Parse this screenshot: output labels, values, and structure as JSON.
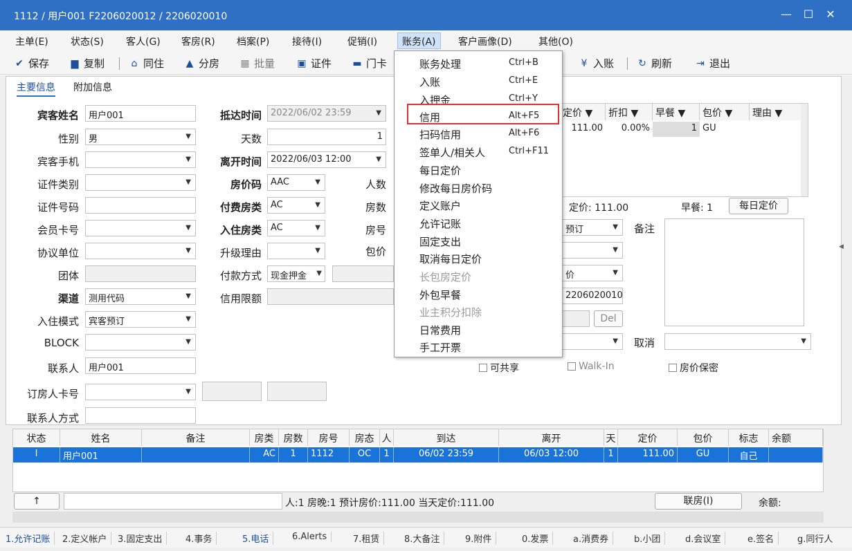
{
  "window": {
    "title": "1112 / 用户001 F2206020012 / 2206020010",
    "minimize": "—",
    "maximize": "☐",
    "close": "✕"
  },
  "menubar": [
    "主单(E)",
    "状态(S)",
    "客人(G)",
    "客房(R)",
    "档案(P)",
    "接待(I)",
    "促销(I)",
    "账务(A)",
    "客户画像(D)",
    "其他(O)"
  ],
  "toolbar": {
    "save": "保存",
    "copy": "复制",
    "cohabit": "同住",
    "split": "分房",
    "batch": "批量",
    "cert": "证件",
    "doorcard": "门卡",
    "post": "入账",
    "refresh": "刷新",
    "exit": "退出"
  },
  "tabs": {
    "main": "主要信息",
    "extra": "附加信息"
  },
  "form": {
    "guest_name_label": "宾客姓名",
    "guest_name": "用户001",
    "gender_label": "性别",
    "gender": "男",
    "phone_label": "宾客手机",
    "phone": "",
    "id_type_label": "证件类别",
    "id_type": "",
    "id_no_label": "证件号码",
    "id_no": "",
    "member_label": "会员卡号",
    "member": "",
    "agreement_label": "协议单位",
    "agreement": "",
    "group_label": "团体",
    "group": "",
    "channel_label": "渠道",
    "channel": "测用代码",
    "mode_label": "入住模式",
    "mode": "宾客预订",
    "block_label": "BLOCK",
    "block": "",
    "contact_label": "联系人",
    "contact": "用户001",
    "booker_card_label": "订房人卡号",
    "booker_card": "",
    "contact_way_label": "联系人方式",
    "contact_way": "",
    "arrival_label": "抵达时间",
    "arrival": "2022/06/02 23:59",
    "days_label": "天数",
    "days": "1",
    "depart_label": "离开时间",
    "depart": "2022/06/03 12:00",
    "rate_code_label": "房价码",
    "rate_code": "AAC",
    "pay_type_label": "付费房类",
    "pay_type": "AC",
    "room_type_label": "入住房类",
    "room_type": "AC",
    "upgrade_label": "升级理由",
    "upgrade": "",
    "pay_method_label": "付款方式",
    "pay_method": "现金押金",
    "credit_limit_label": "信用限额",
    "credit_limit": "",
    "persons_label": "人数",
    "rooms_label": "房数",
    "roomno_label": "房号",
    "package_label": "包价",
    "booking_status": "预订",
    "price_field": "价",
    "account_no": "2206020010",
    "del": "Del",
    "remark_label": "备注",
    "cancel_label": "取消",
    "shareable": "可共享",
    "walkin": "Walk-In",
    "price_secret": "房价保密",
    "fixed_rate_text": "定价: 111.00",
    "breakfast_text": "早餐: 1",
    "daily_rate_btn": "每日定价"
  },
  "rate_grid": {
    "headers": [
      "定价 ▼",
      "折扣 ▼",
      "早餐 ▼",
      "包价 ▼",
      "理由 ▼"
    ],
    "row": [
      "111.00",
      "0.00%",
      "1",
      "GU",
      ""
    ]
  },
  "account_menu": [
    {
      "label": "账务处理",
      "shortcut": "Ctrl+B"
    },
    {
      "label": "入账",
      "shortcut": "Ctrl+E"
    },
    {
      "label": "入押金",
      "shortcut": "Ctrl+Y"
    },
    {
      "label": "信用",
      "shortcut": "Alt+F5"
    },
    {
      "label": "扫码信用",
      "shortcut": "Alt+F6"
    },
    {
      "label": "签单人/相关人",
      "shortcut": "Ctrl+F11"
    },
    {
      "label": "每日定价",
      "shortcut": ""
    },
    {
      "label": "修改每日房价码",
      "shortcut": ""
    },
    {
      "label": "定义账户",
      "shortcut": ""
    },
    {
      "label": "允许记账",
      "shortcut": ""
    },
    {
      "label": "固定支出",
      "shortcut": ""
    },
    {
      "label": "取消每日定价",
      "shortcut": ""
    },
    {
      "label": "长包房定价",
      "shortcut": ""
    },
    {
      "label": "外包早餐",
      "shortcut": ""
    },
    {
      "label": "业主积分扣除",
      "shortcut": ""
    },
    {
      "label": "日常费用",
      "shortcut": ""
    },
    {
      "label": "手工开票",
      "shortcut": ""
    }
  ],
  "grid": {
    "headers": [
      "状态",
      "姓名",
      "备注",
      "房类",
      "房数",
      "房号",
      "房态",
      "人",
      "到达",
      "离开",
      "天",
      "定价",
      "包价",
      "标志",
      "余额"
    ],
    "row": [
      "I",
      "用户001",
      "",
      "AC",
      "1",
      "1112",
      "OC",
      "1",
      "06/02 23:59",
      "06/03 12:00",
      "1",
      "111.00",
      "GU",
      "自己",
      ""
    ]
  },
  "summary": {
    "up_arrow": "↑",
    "stats": "人:1  房晚:1  预计房价:111.00  当天定价:111.00",
    "link_room": "联房(I)",
    "balance": "余额:"
  },
  "bottom_tabs": [
    "1.允许记账",
    "2.定义帐户",
    "3.固定支出",
    "4.事务",
    "5.电话",
    "6.Alerts",
    "7.租赁",
    "8.大备注",
    "9.附件",
    "0.发票",
    "a.消费券",
    "b.小团",
    "d.会议室",
    "e.签名",
    "g.同行人"
  ]
}
